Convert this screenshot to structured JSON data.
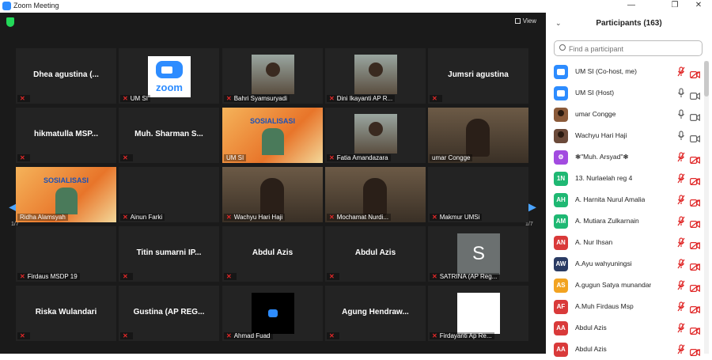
{
  "window": {
    "title": "Zoom Meeting",
    "controls": [
      "minimize",
      "maximize",
      "close"
    ]
  },
  "meeting": {
    "view_label": "View",
    "page_left": "1/7",
    "page_right": "1/7"
  },
  "tiles": [
    {
      "name": "Dhea agustina (...",
      "label": "",
      "muted": true,
      "type": "name"
    },
    {
      "name": "",
      "label": "UM SI",
      "muted": true,
      "type": "zoom-logo"
    },
    {
      "name": "",
      "label": "Bahri Syamsuryadi",
      "muted": true,
      "type": "photo"
    },
    {
      "name": "",
      "label": "Dini Ikayanti AP R...",
      "muted": true,
      "type": "photo"
    },
    {
      "name": "Jumsri agustina",
      "label": "",
      "muted": true,
      "type": "name"
    },
    {
      "name": "hikmatulla  MSP...",
      "label": "",
      "muted": true,
      "type": "name"
    },
    {
      "name": "Muh. Sharman S...",
      "label": "",
      "muted": true,
      "type": "name"
    },
    {
      "name": "",
      "label": "UM SI",
      "muted": false,
      "type": "slide",
      "slide_title": "SOSIALISASI"
    },
    {
      "name": "",
      "label": "Fatia Amandazara",
      "muted": true,
      "type": "photo"
    },
    {
      "name": "",
      "label": "umar Congge",
      "muted": false,
      "type": "video",
      "active": true
    },
    {
      "name": "",
      "label": "Ridha Alamsyah",
      "muted": false,
      "type": "slide",
      "slide_title": "SOSIALISASI"
    },
    {
      "name": "",
      "label": "Ainun Farki",
      "muted": true,
      "type": "blank"
    },
    {
      "name": "",
      "label": "Wachyu Hari Haji",
      "muted": true,
      "type": "video"
    },
    {
      "name": "",
      "label": "Mochamat Nurdi...",
      "muted": true,
      "type": "video"
    },
    {
      "name": "",
      "label": "Makmur UMSi",
      "muted": true,
      "type": "blank"
    },
    {
      "name": "",
      "label": "Firdaus MSDP 19",
      "muted": true,
      "type": "blank"
    },
    {
      "name": "Titin sumarni IP...",
      "label": "",
      "muted": true,
      "type": "name"
    },
    {
      "name": "Abdul Azis",
      "label": "",
      "muted": true,
      "type": "name"
    },
    {
      "name": "Abdul Azis",
      "label": "",
      "muted": true,
      "type": "name"
    },
    {
      "name": "",
      "label": "SATRINA (AP Reg...",
      "muted": true,
      "type": "letter",
      "letter": "S"
    },
    {
      "name": "Riska Wulandari",
      "label": "",
      "muted": true,
      "type": "name"
    },
    {
      "name": "Gustina (AP REG...",
      "label": "",
      "muted": true,
      "type": "name"
    },
    {
      "name": "",
      "label": "Ahmad Fuad",
      "muted": true,
      "type": "zoom-small"
    },
    {
      "name": "Agung  Hendraw...",
      "label": "",
      "muted": true,
      "type": "name"
    },
    {
      "name": "",
      "label": "Firdayanti Ap Re...",
      "muted": true,
      "type": "white"
    }
  ],
  "participants_panel": {
    "title": "Participants (163)",
    "search_placeholder": "Find a participant",
    "items": [
      {
        "name": "UM SI (Co-host, me)",
        "avatar": "zoom",
        "color": "#2d8cff",
        "mic_muted": true,
        "cam_off": true
      },
      {
        "name": "UM SI (Host)",
        "avatar": "zoom",
        "color": "#2d8cff",
        "mic_muted": false,
        "cam_off": false
      },
      {
        "name": "umar Congge",
        "avatar": "photo",
        "color": "#8a5a3a",
        "mic_muted": false,
        "cam_off": false
      },
      {
        "name": "Wachyu Hari Haji",
        "avatar": "photo",
        "color": "#6b4a3a",
        "mic_muted": false,
        "cam_off": false
      },
      {
        "name": "❃\"Muh. Arsyad\"❃",
        "avatar": "icon",
        "color": "#a24be0",
        "mic_muted": true,
        "cam_off": true
      },
      {
        "name": "13. Nurlaelah reg 4",
        "initials": "1N",
        "color": "#1fb873",
        "mic_muted": true,
        "cam_off": true
      },
      {
        "name": "A. Harnita Nurul Amalia",
        "initials": "AH",
        "color": "#1fb873",
        "mic_muted": true,
        "cam_off": true
      },
      {
        "name": "A. Mutiara Zulkarnain",
        "initials": "AM",
        "color": "#1fb873",
        "mic_muted": true,
        "cam_off": true
      },
      {
        "name": "A. Nur Ihsan",
        "initials": "AN",
        "color": "#d93a3a",
        "mic_muted": true,
        "cam_off": true
      },
      {
        "name": "A.Ayu wahyuningsi",
        "initials": "AW",
        "color": "#2a3b63",
        "mic_muted": true,
        "cam_off": true
      },
      {
        "name": "A.gugun Satya munandar",
        "initials": "AS",
        "color": "#f2a321",
        "mic_muted": true,
        "cam_off": true
      },
      {
        "name": "A.Muh Firdaus Msp",
        "initials": "AF",
        "color": "#d93a3a",
        "mic_muted": true,
        "cam_off": true
      },
      {
        "name": "Abdul Azis",
        "initials": "AA",
        "color": "#d93a3a",
        "mic_muted": true,
        "cam_off": true
      },
      {
        "name": "Abdul Azis",
        "initials": "AA",
        "color": "#d93a3a",
        "mic_muted": true,
        "cam_off": true
      }
    ]
  }
}
